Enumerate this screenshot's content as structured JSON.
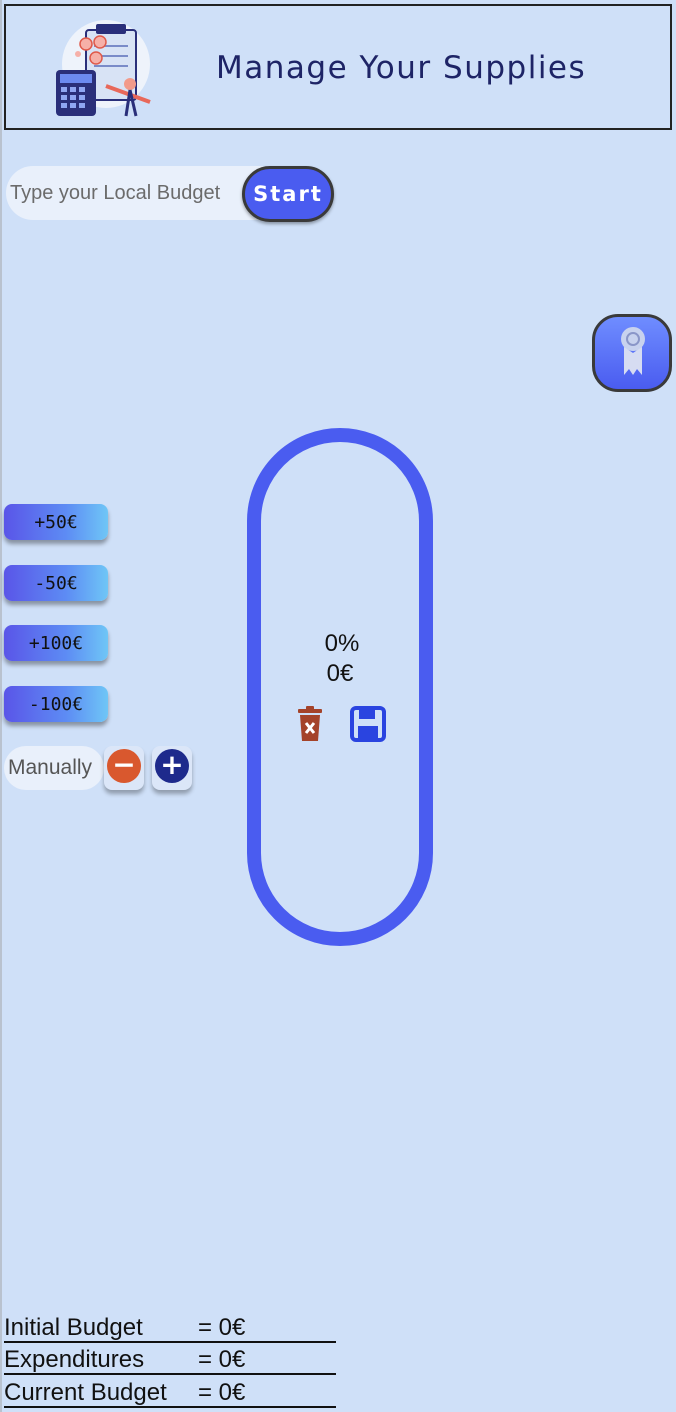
{
  "header": {
    "title": "Manage Your Supplies"
  },
  "budget": {
    "placeholder": "Type your Local Budget",
    "start_label": "Start"
  },
  "quick_buttons": [
    "+50€",
    "-50€",
    "+100€",
    "-100€"
  ],
  "manual": {
    "placeholder": "Manually",
    "minus_icon": "minus-icon",
    "plus_icon": "plus-icon"
  },
  "gauge": {
    "percent": "0%",
    "amount": "0€",
    "fill_fraction": 0
  },
  "summary": [
    {
      "label": "Initial Budget",
      "value": "= 0€"
    },
    {
      "label": "Expenditures",
      "value": "= 0€"
    },
    {
      "label": "Current Budget",
      "value": "= 0€"
    }
  ],
  "colors": {
    "background": "#cfe0f8",
    "accent": "#4a5cf0",
    "minus": "#d9582e",
    "plus": "#1e2a8c",
    "trash": "#a4432a",
    "save": "#2a44e0"
  }
}
